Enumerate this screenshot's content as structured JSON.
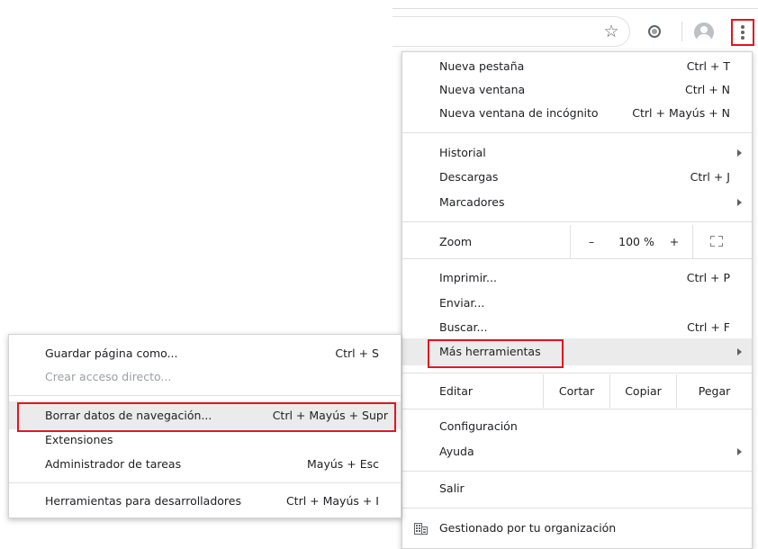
{
  "toolbar": {
    "bookmark_icon": "star-outline-icon",
    "extension_icon": "circle-extension-icon",
    "profile_icon": "avatar-icon",
    "menu_icon": "three-dots-vertical-icon",
    "highlight_color": "#e0161f"
  },
  "menu": {
    "new_tab": {
      "label": "Nueva pestaña",
      "shortcut": "Ctrl + T"
    },
    "new_window": {
      "label": "Nueva ventana",
      "shortcut": "Ctrl + N"
    },
    "incognito": {
      "label": "Nueva ventana de incógnito",
      "shortcut": "Ctrl + Mayús + N"
    },
    "history": {
      "label": "Historial"
    },
    "downloads": {
      "label": "Descargas",
      "shortcut": "Ctrl + J"
    },
    "bookmarks": {
      "label": "Marcadores"
    },
    "zoom": {
      "label": "Zoom",
      "minus": "–",
      "value": "100 %",
      "plus": "+"
    },
    "print": {
      "label": "Imprimir...",
      "shortcut": "Ctrl + P"
    },
    "cast": {
      "label": "Enviar..."
    },
    "find": {
      "label": "Buscar...",
      "shortcut": "Ctrl + F"
    },
    "more_tools": {
      "label": "Más herramientas"
    },
    "edit": {
      "label": "Editar",
      "cut": "Cortar",
      "copy": "Copiar",
      "paste": "Pegar"
    },
    "settings": {
      "label": "Configuración"
    },
    "help": {
      "label": "Ayuda"
    },
    "exit": {
      "label": "Salir"
    },
    "managed": {
      "label": "Gestionado por tu organización"
    }
  },
  "submenu": {
    "save_page": {
      "label": "Guardar página como...",
      "shortcut": "Ctrl + S"
    },
    "create_shortcut": {
      "label": "Crear acceso directo..."
    },
    "clear_data": {
      "label": "Borrar datos de navegación...",
      "shortcut": "Ctrl + Mayús + Supr"
    },
    "extensions": {
      "label": "Extensiones"
    },
    "task_manager": {
      "label": "Administrador de tareas",
      "shortcut": "Mayús + Esc"
    },
    "dev_tools": {
      "label": "Herramientas para desarrolladores",
      "shortcut": "Ctrl + Mayús + I"
    }
  }
}
